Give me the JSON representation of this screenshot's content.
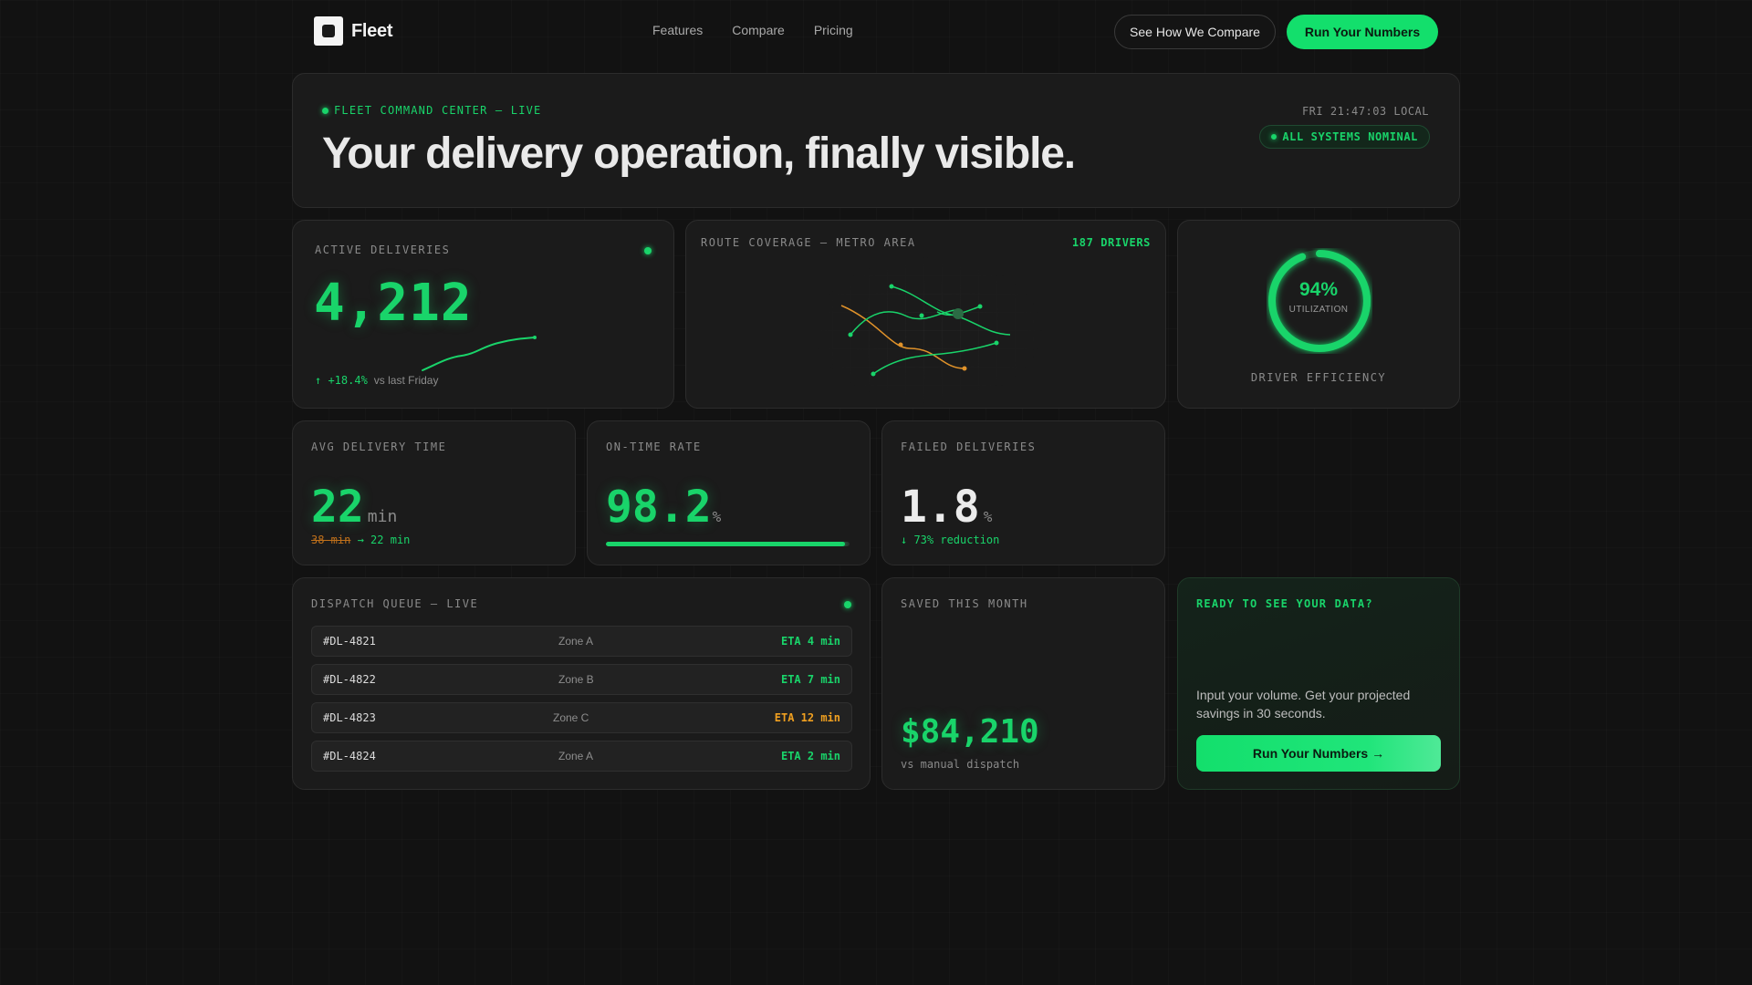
{
  "nav": {
    "brand": "Fleet",
    "links": [
      "Features",
      "Compare",
      "Pricing"
    ],
    "compare_button": "See How We Compare",
    "cta_button": "Run Your Numbers"
  },
  "hero": {
    "tag": "FLEET COMMAND CENTER — LIVE",
    "title": "Your delivery operation, finally visible.",
    "time": "FRI 21:47:03 LOCAL",
    "status": "ALL SYSTEMS NOMINAL"
  },
  "active": {
    "label": "ACTIVE DELIVERIES",
    "value": "4,212",
    "change": "↑ +18.4%",
    "change_note": "vs last Friday"
  },
  "route": {
    "label": "ROUTE COVERAGE — METRO AREA",
    "drivers": "187 DRIVERS"
  },
  "gauge": {
    "value_pct": 94,
    "value_text": "94%",
    "sub": "UTILIZATION",
    "label": "DRIVER EFFICIENCY"
  },
  "avg": {
    "label": "AVG DELIVERY TIME",
    "value": "22",
    "unit": "min",
    "old": "38 min",
    "new": "→ 22 min"
  },
  "ontime": {
    "label": "ON-TIME RATE",
    "value": "98.2",
    "unit": "%",
    "progress": 98.2
  },
  "failed": {
    "label": "FAILED DELIVERIES",
    "value": "1.8",
    "unit": "%",
    "sub": "↓ 73% reduction"
  },
  "queue": {
    "label": "DISPATCH QUEUE — LIVE",
    "rows": [
      {
        "id": "#DL-4821",
        "zone": "Zone A",
        "eta": "ETA 4 min"
      },
      {
        "id": "#DL-4822",
        "zone": "Zone B",
        "eta": "ETA 7 min"
      },
      {
        "id": "#DL-4823",
        "zone": "Zone C",
        "eta": "ETA 12 min"
      },
      {
        "id": "#DL-4824",
        "zone": "Zone A",
        "eta": "ETA 2 min"
      }
    ]
  },
  "saved": {
    "label": "SAVED THIS MONTH",
    "value": "$84,210",
    "sub": "vs manual dispatch"
  },
  "cta": {
    "label": "READY TO SEE YOUR DATA?",
    "text": "Input your volume. Get your projected savings in 30 seconds.",
    "button": "Run Your Numbers →"
  },
  "colors": {
    "accent": "#19d46a",
    "warning": "#f0a020",
    "background": "#121212",
    "card": "#1b1b1b"
  }
}
